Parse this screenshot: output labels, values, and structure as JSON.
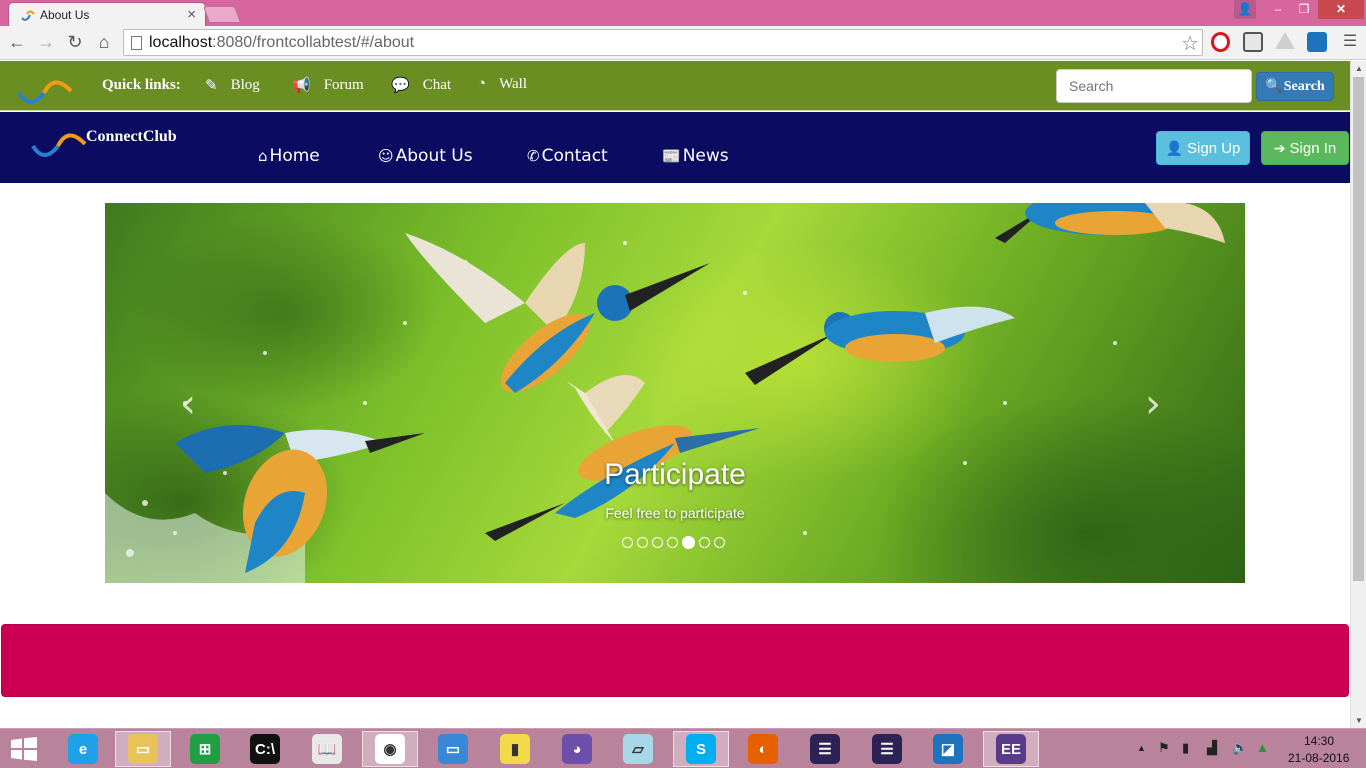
{
  "browser": {
    "tab_title": "About Us",
    "tab_close": "×",
    "url_host": "localhost",
    "url_rest": ":8080/frontcollabtest/#/about",
    "icons": [
      "back-icon",
      "forward-icon",
      "reload-icon",
      "home-icon",
      "page-icon",
      "bookmark-star-icon",
      "opera-icon",
      "malwarebytes-icon",
      "drive-icon",
      "extension-icon",
      "menu-icon"
    ],
    "window_controls": {
      "user": "👤",
      "minimize": "–",
      "maximize": "❐",
      "close": "✕"
    }
  },
  "quick_links": {
    "label": "Quick links:",
    "items": [
      {
        "label": "Blog",
        "icon": "pencil-icon"
      },
      {
        "label": "Forum",
        "icon": "bullhorn-icon"
      },
      {
        "label": "Chat",
        "icon": "comment-icon"
      },
      {
        "label": "Wall",
        "icon": "dashboard-icon"
      }
    ],
    "search_placeholder": "Search",
    "search_button": "Search"
  },
  "navbar": {
    "brand": "ConnectClub",
    "links": [
      {
        "label": "Home",
        "icon": "home-icon"
      },
      {
        "label": "About Us",
        "icon": "smile-icon"
      },
      {
        "label": "Contact",
        "icon": "phone-icon"
      },
      {
        "label": "News",
        "icon": "newspaper-icon"
      }
    ],
    "sign_up": "Sign Up",
    "sign_in": "Sign In"
  },
  "carousel": {
    "caption_title": "Participate",
    "caption_text": "Feel free to participate",
    "slide_count": 7,
    "active_slide": 5,
    "prev": "‹",
    "next": "›"
  },
  "taskbar": {
    "apps": [
      "internet-explorer",
      "file-explorer",
      "store",
      "command-prompt",
      "reader",
      "chrome",
      "remote-desktop",
      "sql-db",
      "github",
      "notepad",
      "skype",
      "firefox",
      "eclipse",
      "eclipse-2",
      "dev-tool",
      "java-ee-ide"
    ],
    "clock_time": "14:30",
    "clock_date": "21-08-2016"
  },
  "colors": {
    "quickbar": "#6b8e23",
    "navbar": "#0b0b61",
    "pinkband": "#cc0052",
    "titlebar": "#d7669f"
  }
}
